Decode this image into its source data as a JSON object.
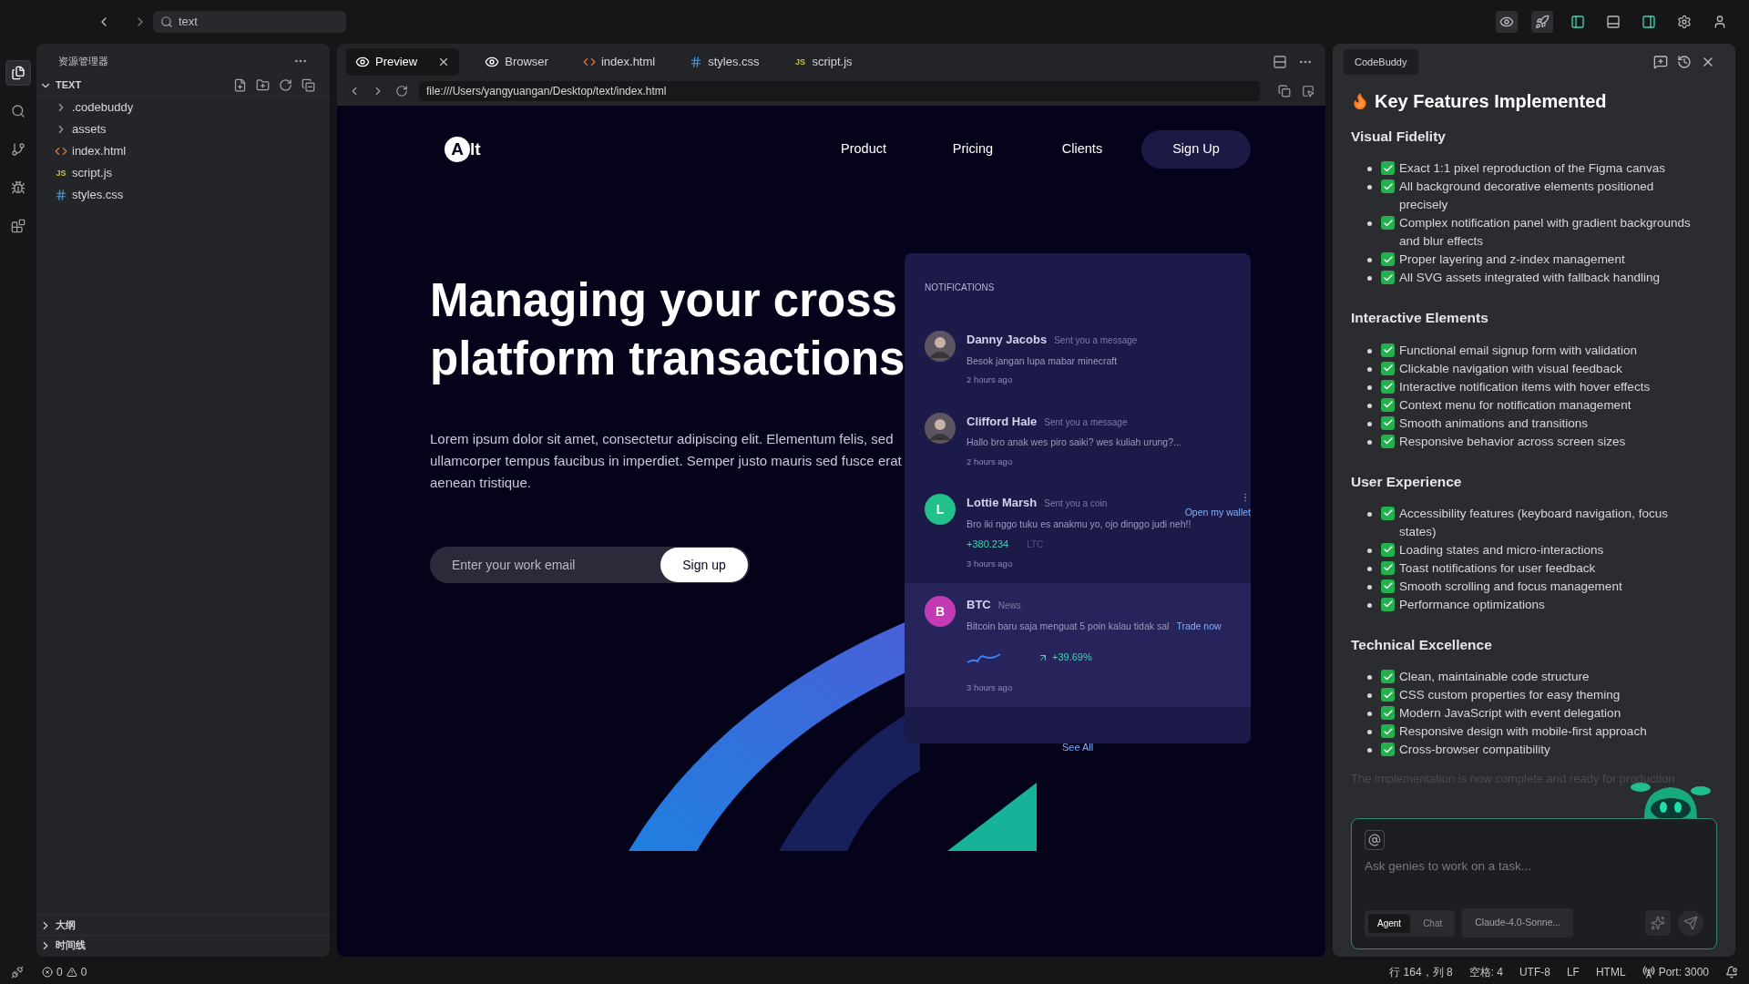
{
  "topbar": {
    "search": {
      "value": "text"
    }
  },
  "activity_bar": [
    {
      "kind": "files",
      "selected": true
    },
    {
      "kind": "search",
      "selected": false
    },
    {
      "kind": "git",
      "selected": false
    },
    {
      "kind": "debug",
      "selected": false
    },
    {
      "kind": "extensions",
      "selected": false
    }
  ],
  "explorer": {
    "title": "资源管理器",
    "folder": {
      "name": "TEXT",
      "expanded": true,
      "children": [
        {
          "name": ".codebuddy",
          "kind": "folder",
          "expanded": false
        },
        {
          "name": "assets",
          "kind": "folder",
          "expanded": false
        },
        {
          "name": "index.html",
          "kind": "html"
        },
        {
          "name": "script.js",
          "kind": "js",
          "badge": "JS"
        },
        {
          "name": "styles.css",
          "kind": "css"
        }
      ]
    },
    "bottom_sections": [
      {
        "name": "大纲",
        "expanded": false
      },
      {
        "name": "时间线",
        "expanded": false
      }
    ]
  },
  "editor": {
    "tabs": [
      {
        "label": "Preview",
        "kind": "preview",
        "selected": true
      },
      {
        "label": "Browser",
        "kind": "preview",
        "selected": false
      },
      {
        "label": "index.html",
        "kind": "html",
        "selected": false
      },
      {
        "label": "styles.css",
        "kind": "css",
        "selected": false
      },
      {
        "label": "script.js",
        "kind": "js",
        "badge": "JS",
        "selected": false
      }
    ],
    "url": "file:///Users/yangyuangan/Desktop/text/index.html"
  },
  "site": {
    "logo": {
      "mark": "A",
      "text": "lt"
    },
    "nav": [
      {
        "label": "Product",
        "kind": "link"
      },
      {
        "label": "Pricing",
        "kind": "link"
      },
      {
        "label": "Clients",
        "kind": "link"
      },
      {
        "label": "Sign Up",
        "kind": "button"
      }
    ],
    "heading": "Managing your cross platform transactions",
    "paragraph": "Lorem ipsum dolor sit amet, consectetur adipiscing elit. Elementum felis, sed ullamcorper tempus faucibus in imperdiet. Semper justo mauris sed fusce erat aenean tristique.",
    "email": {
      "placeholder": "Enter your work email",
      "button": "Sign up"
    },
    "notifications": {
      "title": "NOTIFICATIONS",
      "items": [
        {
          "kind": "message",
          "avatar": {
            "kind": "photo"
          },
          "name": "Danny Jacobs",
          "action": "Sent you a message",
          "message": "Besok jangan lupa mabar minecraft",
          "time": "2 hours ago"
        },
        {
          "kind": "message",
          "avatar": {
            "kind": "photo"
          },
          "name": "Clifford Hale",
          "action": "Sent you a message",
          "message": "Hallo bro anak wes piro saiki? wes kuliah urung?...",
          "time": "2 hours ago"
        },
        {
          "kind": "coin",
          "avatar": {
            "kind": "letter",
            "letter": "L",
            "color": "#22c08a"
          },
          "name": "Lottie Marsh",
          "action": "Sent you a coin",
          "message": "Bro iki nggo tuku es anakmu yo, ojo dinggo judi neh!!",
          "amount": "+380.234",
          "currency": "LTC",
          "link": "Open my wallet",
          "time": "3 hours ago"
        },
        {
          "kind": "news",
          "avatar": {
            "kind": "letter",
            "letter": "B",
            "color": "#c23bb5"
          },
          "name": "BTC",
          "action": "News",
          "message": "Bitcoin baru saja menguat 5 poin kalau tidak sal",
          "link": "Trade now",
          "change": "+39.69%",
          "time": "3 hours ago"
        }
      ],
      "see_all": "See All"
    }
  },
  "assistant": {
    "tab": "CodeBuddy",
    "title": "Key Features Implemented",
    "sections": [
      {
        "heading": "Visual Fidelity",
        "items": [
          "Exact 1:1 pixel reproduction of the Figma canvas",
          "All background decorative elements positioned precisely",
          "Complex notification panel with gradient backgrounds and blur effects",
          "Proper layering and z-index management",
          "All SVG assets integrated with fallback handling"
        ]
      },
      {
        "heading": "Interactive Elements",
        "items": [
          "Functional email signup form with validation",
          "Clickable navigation with visual feedback",
          "Interactive notification items with hover effects",
          "Context menu for notification management",
          "Smooth animations and transitions",
          "Responsive behavior across screen sizes"
        ]
      },
      {
        "heading": "User Experience",
        "items": [
          "Accessibility features (keyboard navigation, focus states)",
          "Loading states and micro-interactions",
          "Toast notifications for user feedback",
          "Smooth scrolling and focus management",
          "Performance optimizations"
        ]
      },
      {
        "heading": "Technical Excellence",
        "items": [
          "Clean, maintainable code structure",
          "CSS custom properties for easy theming",
          "Modern JavaScript with event delegation",
          "Responsive design with mobile-first approach",
          "Cross-browser compatibility"
        ]
      }
    ],
    "footer": "The implementation is now complete and ready for production",
    "input": {
      "placeholder": "Ask genies to work on a task...",
      "modes": [
        {
          "label": "Agent",
          "selected": true
        },
        {
          "label": "Chat",
          "selected": false
        }
      ],
      "model": "Claude-4.0-Sonne..."
    }
  },
  "status_bar": {
    "errors": "0",
    "warnings": "0",
    "items": [
      "行 164，列 8",
      "空格: 4",
      "UTF-8",
      "LF",
      "HTML"
    ],
    "port": "Port: 3000"
  }
}
